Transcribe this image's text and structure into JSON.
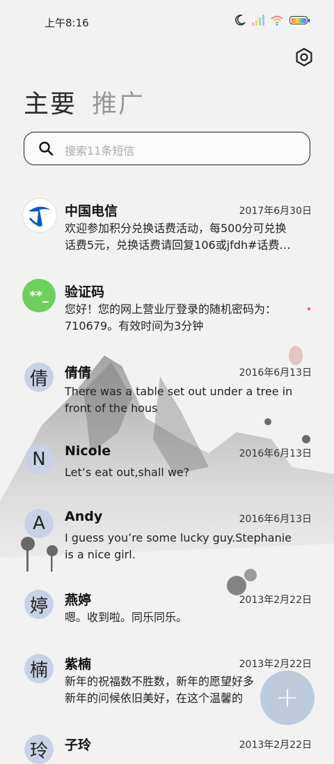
{
  "status": {
    "time": "上午8:16"
  },
  "tabs": [
    {
      "label": "主要",
      "active": true
    },
    {
      "label": "推广",
      "active": false
    }
  ],
  "search": {
    "placeholder": "搜索11条短信"
  },
  "conversations": [
    {
      "name": "中国电信",
      "date": "2017年6月30日",
      "preview": "欢迎参加积分兑换话费活动，每500分可兑换\n话费5元，兑换话费请回复106或jfdh#话费…",
      "avatar": "telecom-logo"
    },
    {
      "name": "验证码",
      "date": "",
      "preview": "您好！您的网上营业厅登录的随机密码为：\n710679。有效时间为3分钟",
      "avatar_text": "**_"
    },
    {
      "name": "倩倩",
      "date": "2016年6月13日",
      "preview": "There was a table set out under a tree in\nfront of the hous",
      "avatar_text": "倩"
    },
    {
      "name": "Nicole",
      "date": "2016年6月13日",
      "preview": "Let’s eat out,shall we?",
      "avatar_text": "N"
    },
    {
      "name": "Andy",
      "date": "2016年6月13日",
      "preview": "I guess you’re some lucky guy.Stephanie\nis a nice girl.",
      "avatar_text": "A"
    },
    {
      "name": "燕婷",
      "date": "2013年2月22日",
      "preview": "嗯。收到啦。同乐同乐。",
      "avatar_text": "婷"
    },
    {
      "name": "紫楠",
      "date": "2013年2月22日",
      "preview": "新年的祝福数不胜数，新年的愿望好多\n新年的问候依旧美好，在这个温馨的",
      "avatar_text": "楠"
    },
    {
      "name": "子玲",
      "date": "2013年2月22日",
      "preview": "",
      "avatar_text": "玲"
    }
  ],
  "colors": {
    "avatar_bg": "#c8d2e4",
    "code_avatar": "#6ed05a",
    "telecom": "#0a5cc4",
    "fab": "#b8c6da"
  },
  "fab": {
    "icon": "plus-icon"
  }
}
